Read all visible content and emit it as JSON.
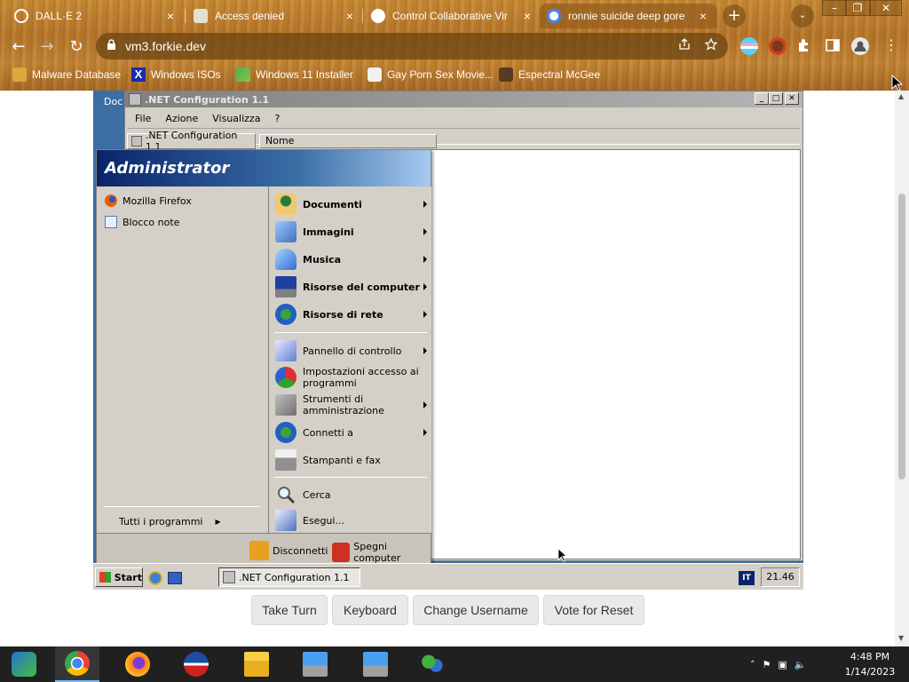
{
  "browser": {
    "tabs": [
      {
        "title": "DALL·E 2",
        "active": false
      },
      {
        "title": "Access denied",
        "active": false
      },
      {
        "title": "Control Collaborative Vir",
        "active": false
      },
      {
        "title": "ronnie suicide deep gore",
        "active": true
      }
    ],
    "tab_close_glyph": "×",
    "new_tab_glyph": "+",
    "tab_search_glyph": "⌄",
    "window_controls": [
      "–",
      "❐",
      "✕"
    ],
    "nav": {
      "back": "←",
      "forward": "→",
      "reload": "↻"
    },
    "url": "vm3.forkie.dev",
    "lock_glyph": "🔒",
    "omnibox_icons": [
      "share-icon",
      "star-icon"
    ],
    "bookmarks": [
      {
        "label": "Malware Database"
      },
      {
        "label": "Windows ISOs"
      },
      {
        "label": "Windows 11 Installer"
      },
      {
        "label": "Gay Porn Sex Movie..."
      },
      {
        "label": "Espectral McGee"
      }
    ],
    "theme": {
      "accent": "#c48534"
    }
  },
  "vm": {
    "desktop_label": "Doc",
    "net_window": {
      "title": ".NET Configuration 1.1",
      "menu": [
        "File",
        "Azione",
        "Visualizza",
        "?"
      ],
      "tree_root": ".NET Configuration 1.1",
      "column_header": "Nome"
    },
    "start_menu": {
      "user": "Administrator",
      "pinned": [
        {
          "label": "Mozilla Firefox",
          "icon": "firefox-icon"
        },
        {
          "label": "Blocco note",
          "icon": "notepad-icon"
        }
      ],
      "all_programs": "Tutti i programmi",
      "right_items": [
        {
          "label": "Documenti",
          "bold": true,
          "submenu": true,
          "icon": "documents-icon"
        },
        {
          "label": "Immagini",
          "bold": true,
          "submenu": true,
          "icon": "pictures-icon"
        },
        {
          "label": "Musica",
          "bold": true,
          "submenu": true,
          "icon": "music-icon"
        },
        {
          "label": "Risorse del computer",
          "bold": true,
          "submenu": true,
          "icon": "computer-icon"
        },
        {
          "label": "Risorse di rete",
          "bold": true,
          "submenu": true,
          "icon": "network-icon"
        },
        {
          "label": "Pannello di controllo",
          "bold": false,
          "submenu": true,
          "icon": "control-panel-icon"
        },
        {
          "label": "Impostazioni accesso ai programmi",
          "bold": false,
          "submenu": false,
          "icon": "program-access-icon"
        },
        {
          "label": "Strumenti di amministrazione",
          "bold": false,
          "submenu": true,
          "icon": "admin-tools-icon"
        },
        {
          "label": "Connetti a",
          "bold": false,
          "submenu": true,
          "icon": "connect-icon"
        },
        {
          "label": "Stampanti e fax",
          "bold": false,
          "submenu": false,
          "icon": "printer-icon"
        },
        {
          "label": "Cerca",
          "bold": false,
          "submenu": false,
          "icon": "search-icon"
        },
        {
          "label": "Esegui...",
          "bold": false,
          "submenu": false,
          "icon": "run-icon"
        }
      ],
      "logoff": "Disconnetti",
      "shutdown": "Spegni computer"
    },
    "taskbar": {
      "start": "Start",
      "task": ".NET Configuration 1.1",
      "lang": "IT",
      "clock": "21.46"
    },
    "actions": [
      "Take Turn",
      "Keyboard",
      "Change Username",
      "Vote for Reset"
    ]
  },
  "os_taskbar": {
    "apps": [
      "vmware-icon",
      "chrome-icon",
      "firefox-icon",
      "obama-icon",
      "file-explorer-icon",
      "network-computer-icon",
      "network-computer-icon",
      "network-users-icon"
    ],
    "time": "4:48 PM",
    "date": "1/14/2023"
  }
}
